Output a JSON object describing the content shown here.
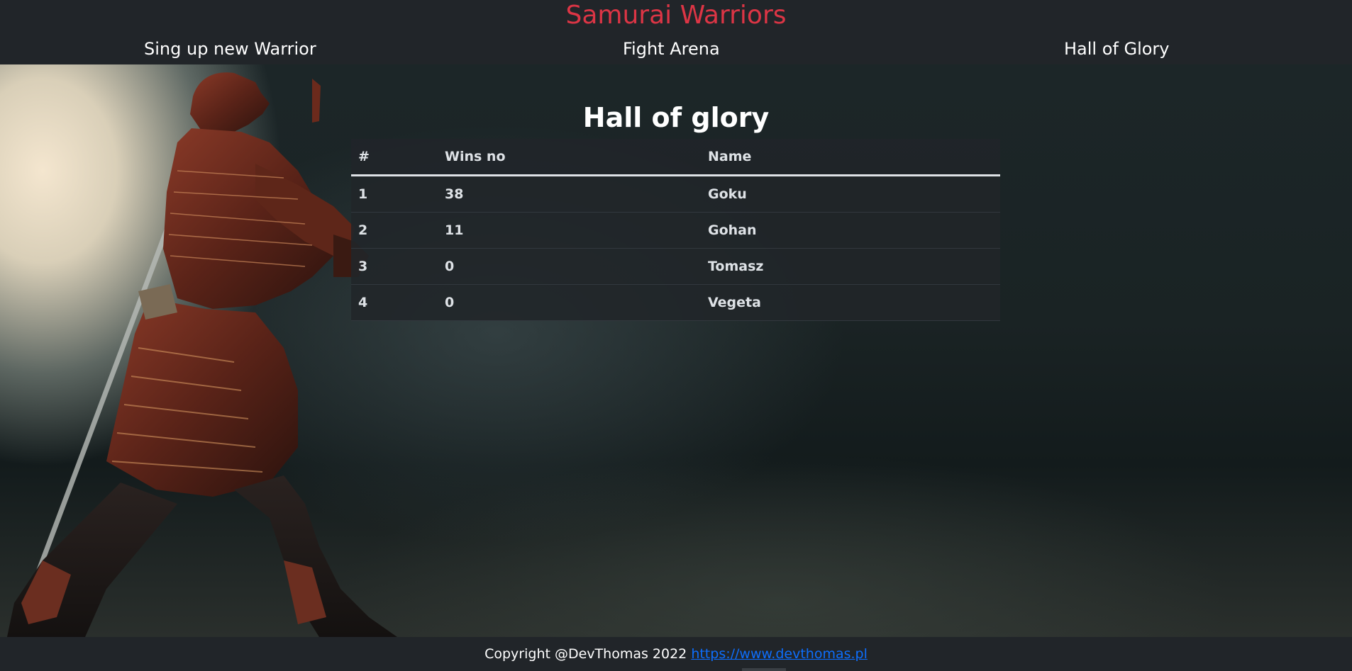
{
  "header": {
    "title": "Samurai Warriors",
    "nav": {
      "signup": "Sing up new Warrior",
      "arena": "Fight Arena",
      "hall": "Hall of Glory"
    }
  },
  "main": {
    "heading": "Hall of glory",
    "table": {
      "columns": [
        "#",
        "Wins no",
        "Name"
      ],
      "rows": [
        {
          "rank": "1",
          "wins": "38",
          "name": "Goku"
        },
        {
          "rank": "2",
          "wins": "11",
          "name": "Gohan"
        },
        {
          "rank": "3",
          "wins": "0",
          "name": "Tomasz"
        },
        {
          "rank": "4",
          "wins": "0",
          "name": "Vegeta"
        }
      ]
    }
  },
  "footer": {
    "copyright": "Copyright @DevThomas 2022",
    "link_text": "https://www.devthomas.pl"
  },
  "colors": {
    "brand": "#dc3545",
    "nav_bg": "#212529",
    "link": "#0d6efd",
    "table_text": "#dee2e6"
  },
  "images": {
    "background": "samurai-warrior-background"
  }
}
